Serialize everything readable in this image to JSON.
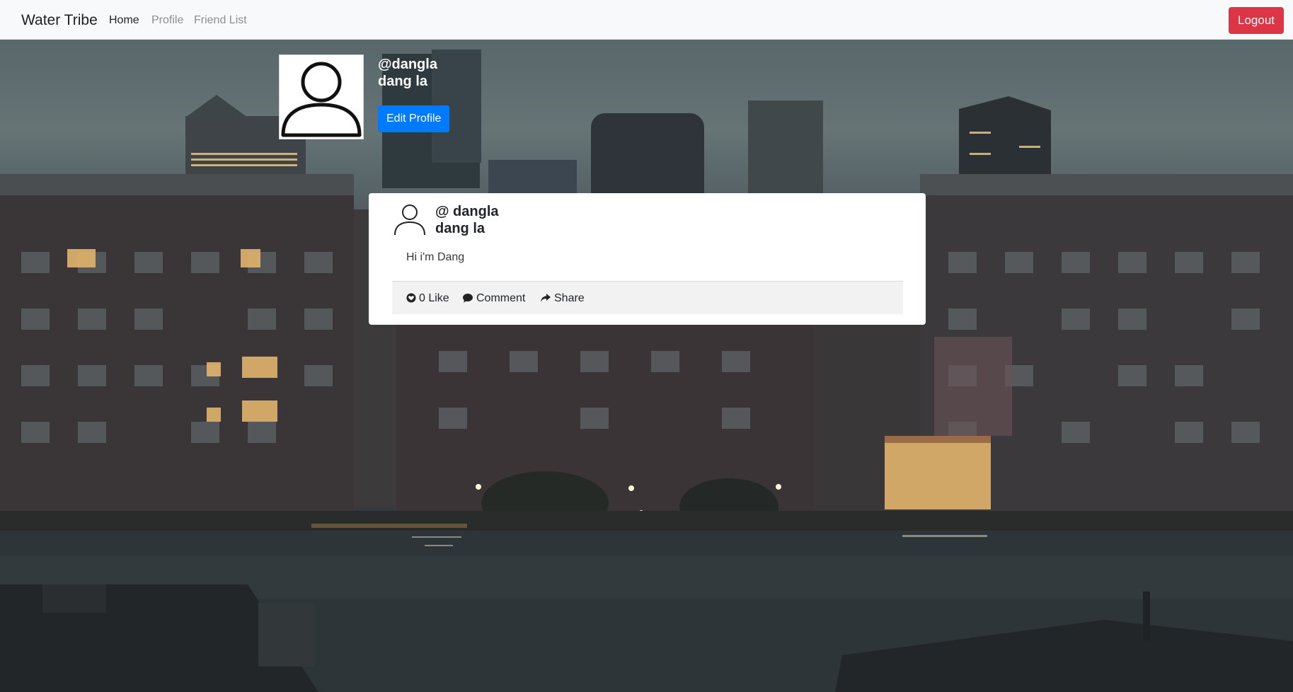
{
  "navbar": {
    "brand": "Water Tribe",
    "links": [
      {
        "label": "Home",
        "active": true
      },
      {
        "label": "Profile",
        "active": false
      },
      {
        "label": "Friend List",
        "active": false
      }
    ],
    "logout_label": "Logout"
  },
  "profile": {
    "avatar_icon": "user-silhouette-icon",
    "handle": "@dangla",
    "name": "dang la",
    "edit_label": "Edit Profile"
  },
  "post": {
    "avatar_icon": "user-silhouette-icon",
    "handle": "@ dangla",
    "name": "dang la",
    "body": "Hi i'm Dang",
    "actions": {
      "like_label": "0 Like",
      "comment_label": "Comment",
      "share_label": "Share"
    }
  },
  "colors": {
    "logout": "#dc3545",
    "edit_profile": "#007bff",
    "navbar_bg": "#f8f9fa"
  }
}
